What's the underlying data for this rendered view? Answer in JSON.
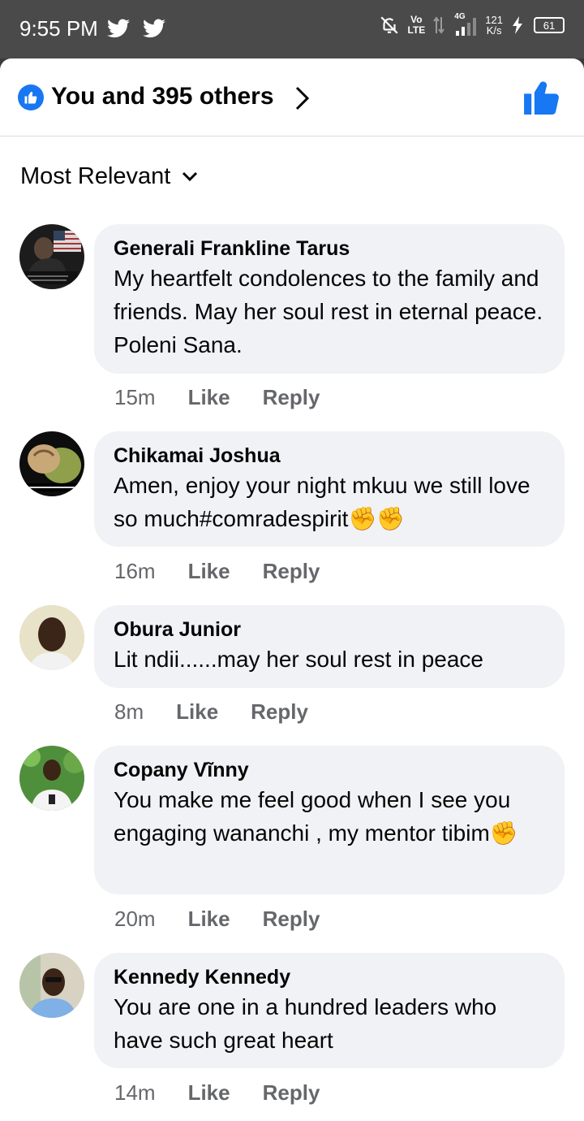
{
  "status_bar": {
    "time": "9:55 PM",
    "vo_top": "Vo",
    "vo_bottom": "LTE",
    "net_gen": "4G",
    "speed_value": "121",
    "speed_unit": "K/s",
    "battery": "61"
  },
  "reactions": {
    "summary": "You and 395 others"
  },
  "filter": {
    "label": "Most Relevant"
  },
  "comments": [
    {
      "author": "Generali Frankline Tarus",
      "text": "My heartfelt condolences to the family and friends. May her soul rest in eternal peace. Poleni Sana.",
      "time": "15m",
      "like": "Like",
      "reply": "Reply"
    },
    {
      "author": "Chikamai Joshua",
      "text": "Amen, enjoy your night mkuu we still love so much#comradespirit✊✊",
      "time": "16m",
      "like": "Like",
      "reply": "Reply"
    },
    {
      "author": "Obura Junior",
      "text": "Lit ndii......may her soul rest in peace",
      "time": "8m",
      "like": "Like",
      "reply": "Reply"
    },
    {
      "author": "Copany Vĩnny",
      "text": "You make me feel good when I see you engaging wananchi , my mentor tibim✊",
      "time": "20m",
      "like": "Like",
      "reply": "Reply"
    },
    {
      "author": "Kennedy Kennedy",
      "text": "You are one in a hundred leaders who have such great heart",
      "time": "14m",
      "like": "Like",
      "reply": "Reply"
    }
  ],
  "colors": {
    "accent": "#1877f2",
    "bubble": "#f0f2f5",
    "meta": "#65676b"
  }
}
